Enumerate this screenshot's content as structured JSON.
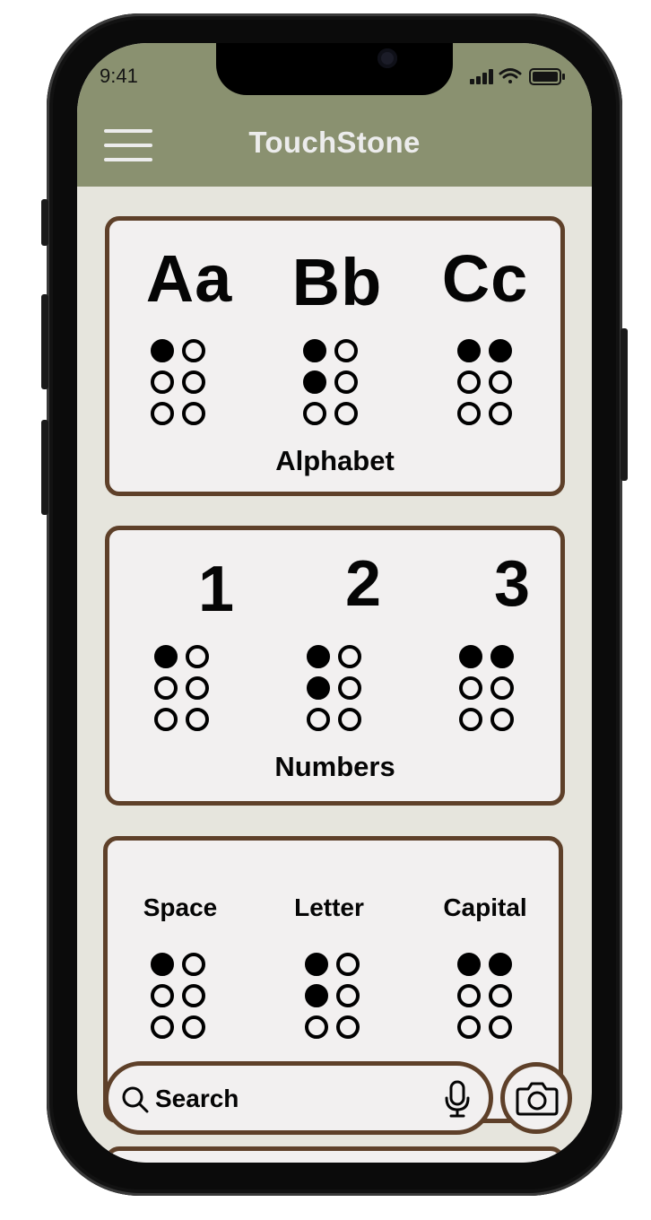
{
  "status_bar": {
    "time": "9:41",
    "icons": [
      "signal-icon",
      "wifi-icon",
      "battery-icon"
    ]
  },
  "header": {
    "menu_icon": "hamburger-menu-icon",
    "title": "TouchStone"
  },
  "colors": {
    "header_bg": "#8a9170",
    "screen_bg": "#e6e5dd",
    "card_bg": "#f2f0f0",
    "card_border": "#5e4029",
    "title_text": "#ececec"
  },
  "cards": [
    {
      "label": "Alphabet",
      "items": [
        {
          "glyph": "Aa",
          "dots": [
            1,
            0,
            0,
            0,
            0,
            0
          ]
        },
        {
          "glyph": "Bb",
          "dots": [
            1,
            0,
            1,
            0,
            0,
            0
          ]
        },
        {
          "glyph": "Cc",
          "dots": [
            1,
            1,
            0,
            0,
            0,
            0
          ]
        }
      ]
    },
    {
      "label": "Numbers",
      "items": [
        {
          "glyph": "1",
          "dots": [
            1,
            0,
            0,
            0,
            0,
            0
          ]
        },
        {
          "glyph": "2",
          "dots": [
            1,
            0,
            1,
            0,
            0,
            0
          ]
        },
        {
          "glyph": "3",
          "dots": [
            1,
            1,
            0,
            0,
            0,
            0
          ]
        }
      ]
    },
    {
      "items": [
        {
          "glyph": "Space",
          "dots": [
            1,
            0,
            0,
            0,
            0,
            0
          ]
        },
        {
          "glyph": "Letter",
          "dots": [
            1,
            0,
            1,
            0,
            0,
            0
          ]
        },
        {
          "glyph": "Capital",
          "dots": [
            1,
            1,
            0,
            0,
            0,
            0
          ]
        }
      ]
    }
  ],
  "search": {
    "label": "Search",
    "search_icon": "search-icon",
    "mic_icon": "microphone-icon"
  },
  "camera_button": {
    "icon": "camera-icon"
  }
}
